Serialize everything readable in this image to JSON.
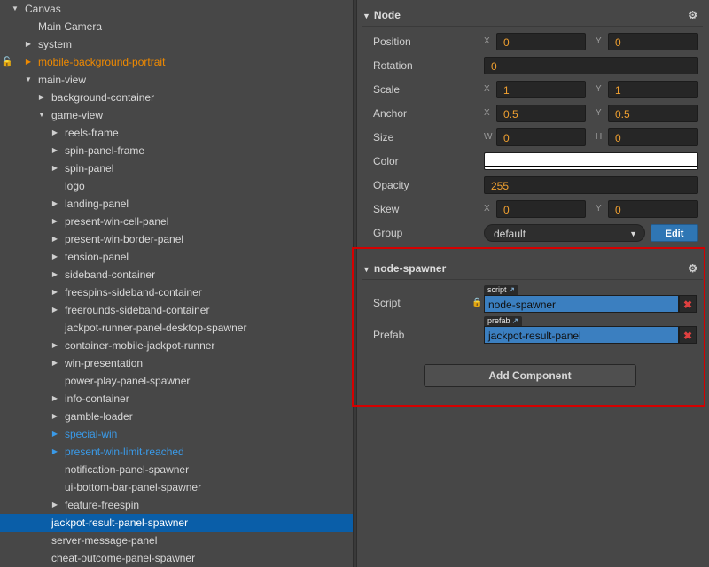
{
  "hierarchy": {
    "items": [
      {
        "label": "Canvas",
        "arrow": "down",
        "indent": 0,
        "style": ""
      },
      {
        "label": "Main Camera",
        "arrow": "",
        "indent": 1,
        "style": ""
      },
      {
        "label": "system",
        "arrow": "right",
        "indent": 1,
        "style": ""
      },
      {
        "label": "mobile-background-portrait",
        "arrow": "right",
        "indent": 1,
        "style": "orange",
        "locked": true
      },
      {
        "label": "main-view",
        "arrow": "down",
        "indent": 1,
        "style": ""
      },
      {
        "label": "background-container",
        "arrow": "right",
        "indent": 2,
        "style": ""
      },
      {
        "label": "game-view",
        "arrow": "down",
        "indent": 2,
        "style": ""
      },
      {
        "label": "reels-frame",
        "arrow": "right",
        "indent": 3,
        "style": ""
      },
      {
        "label": "spin-panel-frame",
        "arrow": "right",
        "indent": 3,
        "style": ""
      },
      {
        "label": "spin-panel",
        "arrow": "right",
        "indent": 3,
        "style": ""
      },
      {
        "label": "logo",
        "arrow": "",
        "indent": 3,
        "style": ""
      },
      {
        "label": "landing-panel",
        "arrow": "right",
        "indent": 3,
        "style": ""
      },
      {
        "label": "present-win-cell-panel",
        "arrow": "right",
        "indent": 3,
        "style": ""
      },
      {
        "label": "present-win-border-panel",
        "arrow": "right",
        "indent": 3,
        "style": ""
      },
      {
        "label": "tension-panel",
        "arrow": "right",
        "indent": 3,
        "style": ""
      },
      {
        "label": "sideband-container",
        "arrow": "right",
        "indent": 3,
        "style": ""
      },
      {
        "label": "freespins-sideband-container",
        "arrow": "right",
        "indent": 3,
        "style": ""
      },
      {
        "label": "freerounds-sideband-container",
        "arrow": "right",
        "indent": 3,
        "style": ""
      },
      {
        "label": "jackpot-runner-panel-desktop-spawner",
        "arrow": "",
        "indent": 3,
        "style": ""
      },
      {
        "label": "container-mobile-jackpot-runner",
        "arrow": "right",
        "indent": 3,
        "style": ""
      },
      {
        "label": "win-presentation",
        "arrow": "right",
        "indent": 3,
        "style": ""
      },
      {
        "label": "power-play-panel-spawner",
        "arrow": "",
        "indent": 3,
        "style": ""
      },
      {
        "label": "info-container",
        "arrow": "right",
        "indent": 3,
        "style": ""
      },
      {
        "label": "gamble-loader",
        "arrow": "right",
        "indent": 3,
        "style": ""
      },
      {
        "label": "special-win",
        "arrow": "right",
        "indent": 3,
        "style": "blue"
      },
      {
        "label": "present-win-limit-reached",
        "arrow": "right",
        "indent": 3,
        "style": "blue"
      },
      {
        "label": "notification-panel-spawner",
        "arrow": "",
        "indent": 3,
        "style": ""
      },
      {
        "label": "ui-bottom-bar-panel-spawner",
        "arrow": "",
        "indent": 3,
        "style": ""
      },
      {
        "label": "feature-freespin",
        "arrow": "right",
        "indent": 3,
        "style": ""
      },
      {
        "label": "jackpot-result-panel-spawner",
        "arrow": "",
        "indent": 2,
        "style": "selected"
      },
      {
        "label": "server-message-panel",
        "arrow": "",
        "indent": 2,
        "style": ""
      },
      {
        "label": "cheat-outcome-panel-spawner",
        "arrow": "",
        "indent": 2,
        "style": ""
      }
    ]
  },
  "node": {
    "title": "Node",
    "position": {
      "label": "Position",
      "x_axis": "X",
      "x": "0",
      "y_axis": "Y",
      "y": "0"
    },
    "rotation": {
      "label": "Rotation",
      "value": "0"
    },
    "scale": {
      "label": "Scale",
      "x_axis": "X",
      "x": "1",
      "y_axis": "Y",
      "y": "1"
    },
    "anchor": {
      "label": "Anchor",
      "x_axis": "X",
      "x": "0.5",
      "y_axis": "Y",
      "y": "0.5"
    },
    "size": {
      "label": "Size",
      "w_axis": "W",
      "w": "0",
      "h_axis": "H",
      "h": "0"
    },
    "color": {
      "label": "Color",
      "value": "#ffffff"
    },
    "opacity": {
      "label": "Opacity",
      "value": "255"
    },
    "skew": {
      "label": "Skew",
      "x_axis": "X",
      "x": "0",
      "y_axis": "Y",
      "y": "0"
    },
    "group": {
      "label": "Group",
      "value": "default",
      "edit_label": "Edit"
    }
  },
  "component": {
    "title": "node-spawner",
    "script": {
      "label": "Script",
      "tag": "script",
      "value": "node-spawner"
    },
    "prefab": {
      "label": "Prefab",
      "tag": "prefab",
      "value": "jackpot-result-panel"
    },
    "add_label": "Add Component"
  },
  "colors": {
    "selected_row": "#0a5ea8",
    "orange_text": "#f08a00",
    "blue_text": "#3a9ae8",
    "value_text": "#f0a030",
    "asset_field": "#3b7fc0",
    "highlight": "#d50000"
  }
}
